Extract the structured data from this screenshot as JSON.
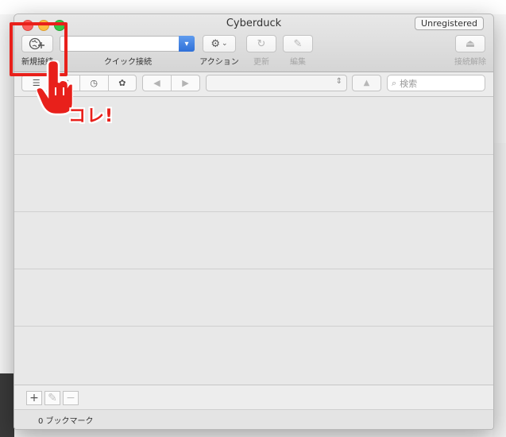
{
  "window": {
    "title": "Cyberduck",
    "badge": "Unregistered"
  },
  "toolbar": {
    "new_connection": "新規接続",
    "quick_connect": "クイック接続",
    "quick_connect_value": "",
    "action": "アクション",
    "refresh": "更新",
    "edit": "編集",
    "disconnect": "接続解除"
  },
  "navbar": {
    "search_placeholder": "検索",
    "path_value": ""
  },
  "bookmarks": {
    "count_text": "0 ブックマーク"
  },
  "annotation": {
    "callout": "コレ!",
    "accent_color": "#e8201b"
  }
}
